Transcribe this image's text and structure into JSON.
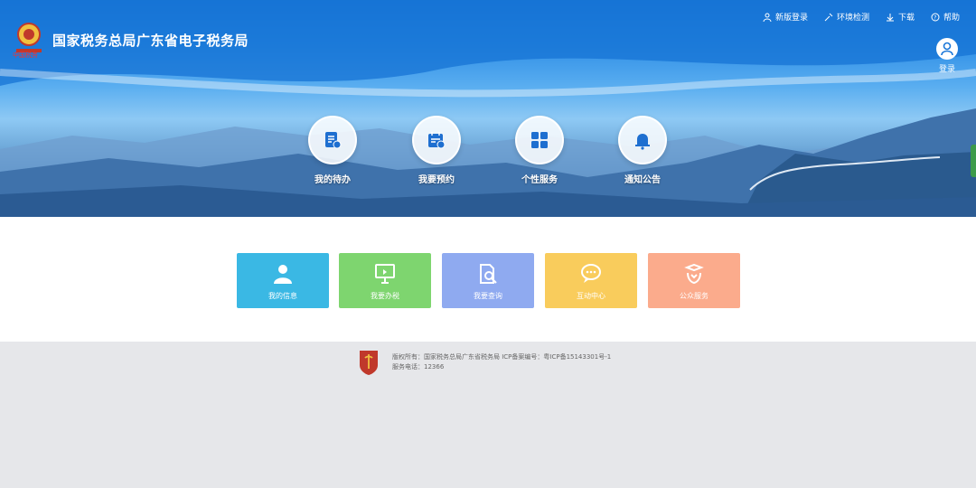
{
  "header": {
    "site_title": "国家税务总局广东省电子税务局",
    "logo_caption": "中国税务",
    "links": [
      {
        "label": "新版登录",
        "icon": "user-icon"
      },
      {
        "label": "环境检测",
        "icon": "wrench-icon"
      },
      {
        "label": "下载",
        "icon": "download-icon"
      },
      {
        "label": "帮助",
        "icon": "help-icon"
      }
    ],
    "login_label": "登录"
  },
  "hero_nav": [
    {
      "label": "我的待办",
      "icon": "todo-icon"
    },
    {
      "label": "我要预约",
      "icon": "calendar-icon"
    },
    {
      "label": "个性服务",
      "icon": "grid-icon"
    },
    {
      "label": "通知公告",
      "icon": "bell-icon"
    }
  ],
  "services": [
    {
      "label": "我的信息",
      "icon": "person-icon",
      "color": "#3ab8e4"
    },
    {
      "label": "我要办税",
      "icon": "monitor-icon",
      "color": "#7ed56f"
    },
    {
      "label": "我要查询",
      "icon": "search-doc-icon",
      "color": "#8faaf0"
    },
    {
      "label": "互动中心",
      "icon": "chat-icon",
      "color": "#f9cc5c"
    },
    {
      "label": "公众服务",
      "icon": "hands-icon",
      "color": "#fbab8c"
    }
  ],
  "footer": {
    "line1": "版权所有：国家税务总局广东省税务局    ICP备案编号：粤ICP备15143301号-1",
    "line2": "服务电话：12366"
  }
}
